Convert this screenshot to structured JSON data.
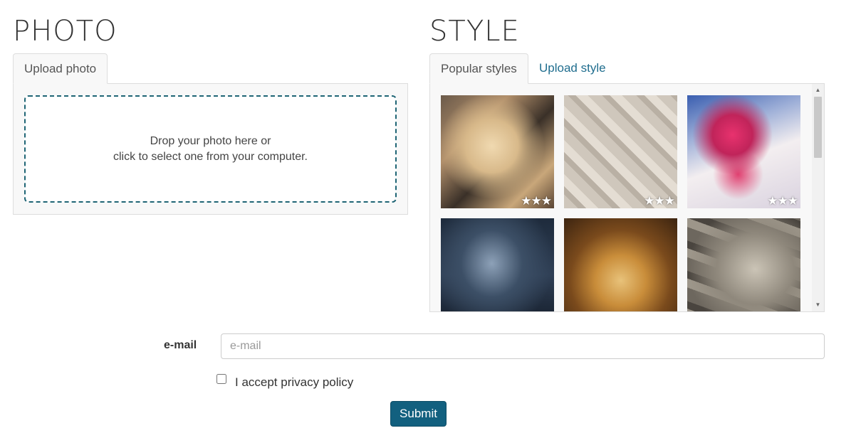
{
  "photo": {
    "heading": "PHOTO",
    "tabs": [
      {
        "label": "Upload photo",
        "active": true
      }
    ],
    "dropzone": {
      "line1": "Drop your photo here or",
      "line2": "click to select one from your computer."
    }
  },
  "style": {
    "heading": "STYLE",
    "tabs": [
      {
        "label": "Popular styles",
        "active": true
      },
      {
        "label": "Upload style",
        "active": false
      }
    ],
    "thumbnails": [
      {
        "stars": "★★★",
        "subject": "cubist-woman-portrait"
      },
      {
        "stars": "★★★",
        "subject": "stone-block-face"
      },
      {
        "stars": "★★★",
        "subject": "pink-flowers-face"
      },
      {
        "subject": "starry-woman-silhouette"
      },
      {
        "subject": "lion-face"
      },
      {
        "subject": "stone-wall-face"
      }
    ]
  },
  "form": {
    "email_label": "e-mail",
    "email_placeholder": "e-mail",
    "email_value": "",
    "privacy_label": "I accept privacy policy",
    "privacy_checked": false,
    "submit_label": "Submit"
  },
  "colors": {
    "accent": "#12607f",
    "link": "#1f6d8e",
    "dropzone_border": "#1f6575"
  }
}
